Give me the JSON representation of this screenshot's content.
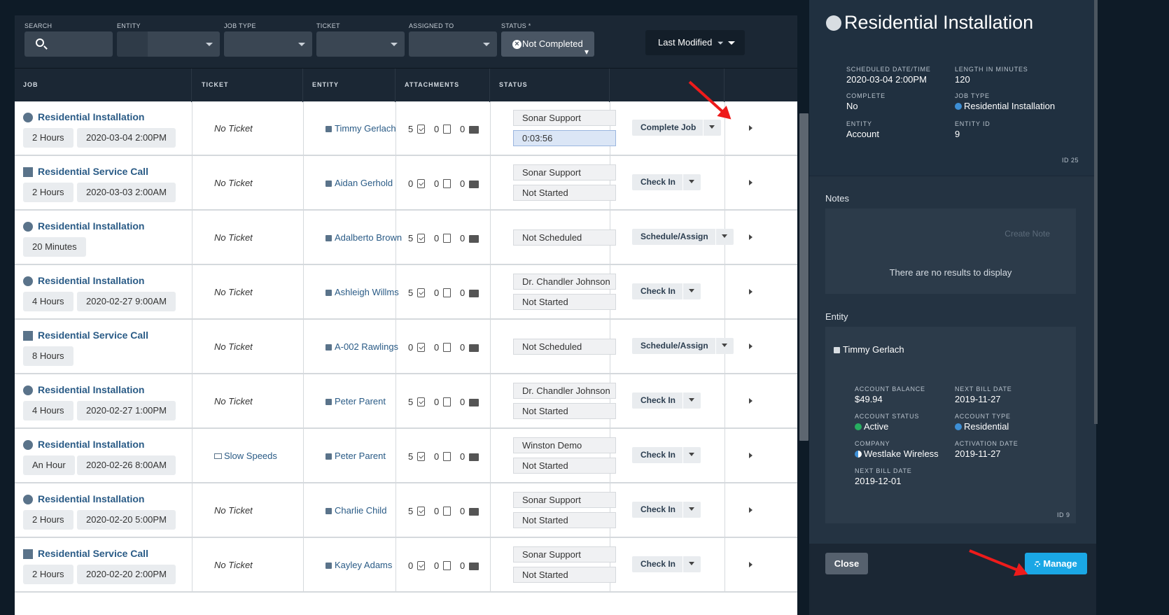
{
  "filters": {
    "search_label": "SEARCH",
    "entity_label": "ENTITY",
    "job_type_label": "JOB TYPE",
    "ticket_label": "TICKET",
    "assigned_label": "ASSIGNED TO",
    "status_label": "STATUS *",
    "status_chip": "Not Completed",
    "sort_label": "Last Modified"
  },
  "columns": [
    "JOB",
    "TICKET",
    "ENTITY",
    "ATTACHMENTS",
    "STATUS"
  ],
  "rows": [
    {
      "shape": "circle",
      "title": "Residential Installation",
      "duration": "2 Hours",
      "date": "2020-03-04 2:00PM",
      "ticket": "No Ticket",
      "ticket_link": false,
      "entity": "Timmy Gerlach",
      "att": [
        "5",
        "0",
        "0"
      ],
      "status1": "Sonar Support",
      "status2": "0:03:56",
      "timer": true,
      "action": "Complete Job"
    },
    {
      "shape": "square",
      "title": "Residential Service Call",
      "duration": "2 Hours",
      "date": "2020-03-03 2:00AM",
      "ticket": "No Ticket",
      "ticket_link": false,
      "entity": "Aidan Gerhold",
      "att": [
        "0",
        "0",
        "0"
      ],
      "status1": "Sonar Support",
      "status2": "Not Started",
      "timer": false,
      "action": "Check In"
    },
    {
      "shape": "circle",
      "title": "Residential Installation",
      "duration": "20 Minutes",
      "date": "",
      "ticket": "No Ticket",
      "ticket_link": false,
      "entity": "Adalberto Brown",
      "att": [
        "5",
        "0",
        "0"
      ],
      "status1": "Not Scheduled",
      "status2": "",
      "timer": false,
      "action": "Schedule/Assign"
    },
    {
      "shape": "circle",
      "title": "Residential Installation",
      "duration": "4 Hours",
      "date": "2020-02-27 9:00AM",
      "ticket": "No Ticket",
      "ticket_link": false,
      "entity": "Ashleigh Willms",
      "att": [
        "5",
        "0",
        "0"
      ],
      "status1": "Dr. Chandler Johnson",
      "status2": "Not Started",
      "timer": false,
      "action": "Check In"
    },
    {
      "shape": "square",
      "title": "Residential Service Call",
      "duration": "8 Hours",
      "date": "",
      "ticket": "No Ticket",
      "ticket_link": false,
      "entity": "A-002 Rawlings",
      "att": [
        "0",
        "0",
        "0"
      ],
      "status1": "Not Scheduled",
      "status2": "",
      "timer": false,
      "action": "Schedule/Assign"
    },
    {
      "shape": "circle",
      "title": "Residential Installation",
      "duration": "4 Hours",
      "date": "2020-02-27 1:00PM",
      "ticket": "No Ticket",
      "ticket_link": false,
      "entity": "Peter Parent",
      "att": [
        "5",
        "0",
        "0"
      ],
      "status1": "Dr. Chandler Johnson",
      "status2": "Not Started",
      "timer": false,
      "action": "Check In"
    },
    {
      "shape": "circle",
      "title": "Residential Installation",
      "duration": "An Hour",
      "date": "2020-02-26 8:00AM",
      "ticket": "Slow Speeds",
      "ticket_link": true,
      "entity": "Peter Parent",
      "att": [
        "5",
        "0",
        "0"
      ],
      "status1": "Winston Demo",
      "status2": "Not Started",
      "timer": false,
      "action": "Check In"
    },
    {
      "shape": "circle",
      "title": "Residential Installation",
      "duration": "2 Hours",
      "date": "2020-02-20 5:00PM",
      "ticket": "No Ticket",
      "ticket_link": false,
      "entity": "Charlie Child",
      "att": [
        "5",
        "0",
        "0"
      ],
      "status1": "Sonar Support",
      "status2": "Not Started",
      "timer": false,
      "action": "Check In"
    },
    {
      "shape": "square",
      "title": "Residential Service Call",
      "duration": "2 Hours",
      "date": "2020-02-20 2:00PM",
      "ticket": "No Ticket",
      "ticket_link": false,
      "entity": "Kayley Adams",
      "att": [
        "0",
        "0",
        "0"
      ],
      "status1": "Sonar Support",
      "status2": "Not Started",
      "timer": false,
      "action": "Check In"
    }
  ],
  "detail": {
    "title": "Residential Installation",
    "scheduled_label": "SCHEDULED DATE/TIME",
    "scheduled_value": "2020-03-04 2:00PM",
    "length_label": "LENGTH IN MINUTES",
    "length_value": "120",
    "complete_label": "COMPLETE",
    "complete_value": "No",
    "job_type_label": "JOB TYPE",
    "job_type_value": "Residential Installation",
    "entity_label": "ENTITY",
    "entity_value": "Account",
    "entity_id_label": "ENTITY ID",
    "entity_id_value": "9",
    "id_tag": "ID 25",
    "notes_label": "Notes",
    "create_note": "Create Note",
    "no_results": "There are no results to display",
    "entity_section_label": "Entity",
    "entity_name": "Timmy Gerlach",
    "account_balance_label": "ACCOUNT BALANCE",
    "account_balance_value": "$49.94",
    "next_bill_label": "NEXT BILL DATE",
    "next_bill_value": "2019-11-27",
    "account_status_label": "ACCOUNT STATUS",
    "account_status_value": "Active",
    "account_type_label": "ACCOUNT TYPE",
    "account_type_value": "Residential",
    "company_label": "COMPANY",
    "company_value": "Westlake Wireless",
    "activation_label": "ACTIVATION DATE",
    "activation_value": "2019-11-27",
    "next_bill2_label": "NEXT BILL DATE",
    "next_bill2_value": "2019-12-01",
    "entity_id_tag": "ID 9",
    "close_label": "Close",
    "manage_label": "Manage"
  },
  "colors": {
    "accent": "#1aa7e5",
    "link": "#2a5b86",
    "header": "#1b2734",
    "active_status": "#27ae60",
    "job_type_dot": "#3d8fd6",
    "annotation_arrow": "#ee1b1b"
  }
}
